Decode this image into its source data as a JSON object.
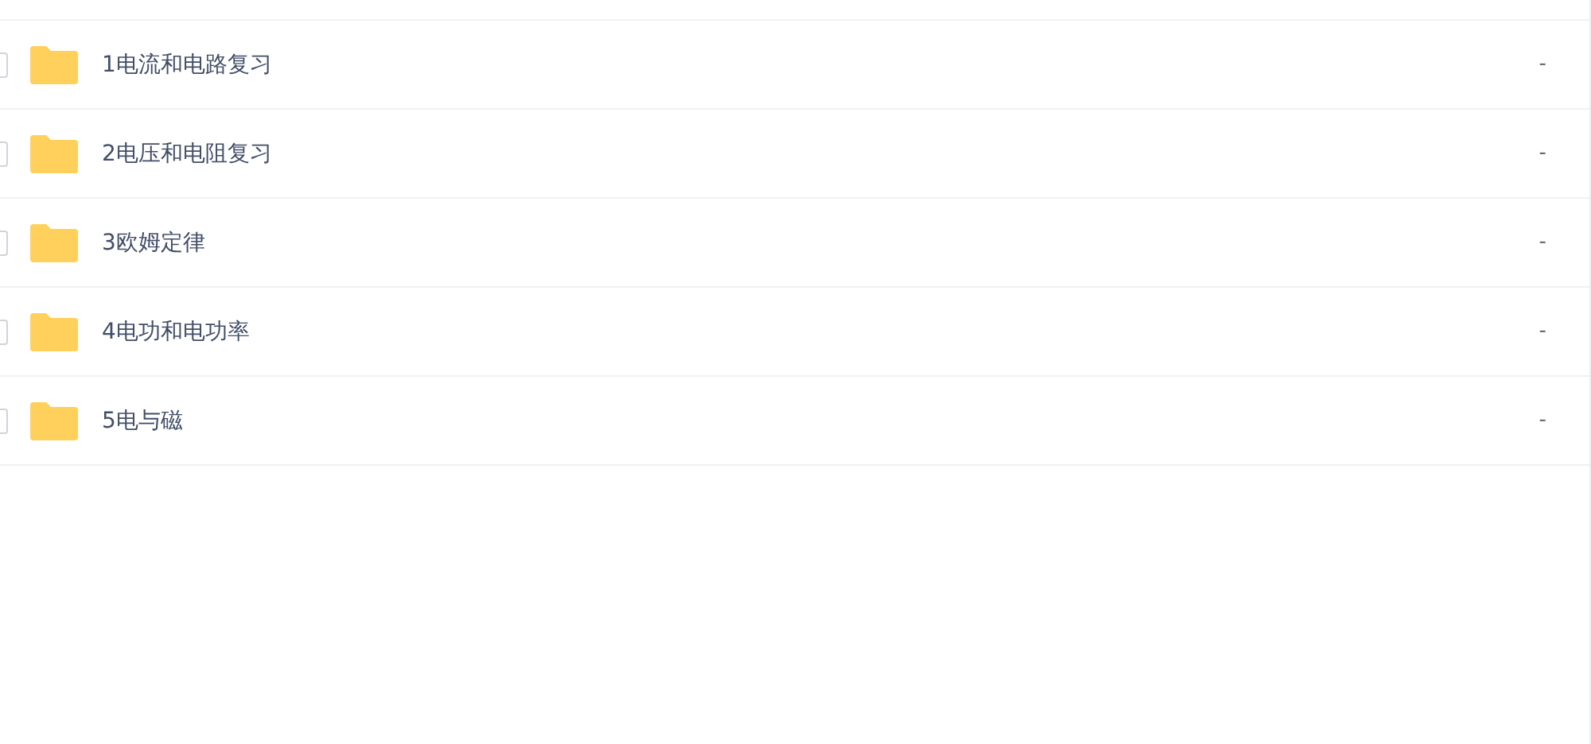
{
  "files": [
    {
      "name": "1电流和电路复习",
      "size": "-",
      "checked": false
    },
    {
      "name": "2电压和电阻复习",
      "size": "-",
      "checked": false
    },
    {
      "name": "3欧姆定律",
      "size": "-",
      "checked": false
    },
    {
      "name": "4电功和电功率",
      "size": "-",
      "checked": false
    },
    {
      "name": "5电与磁",
      "size": "-",
      "checked": false
    }
  ]
}
